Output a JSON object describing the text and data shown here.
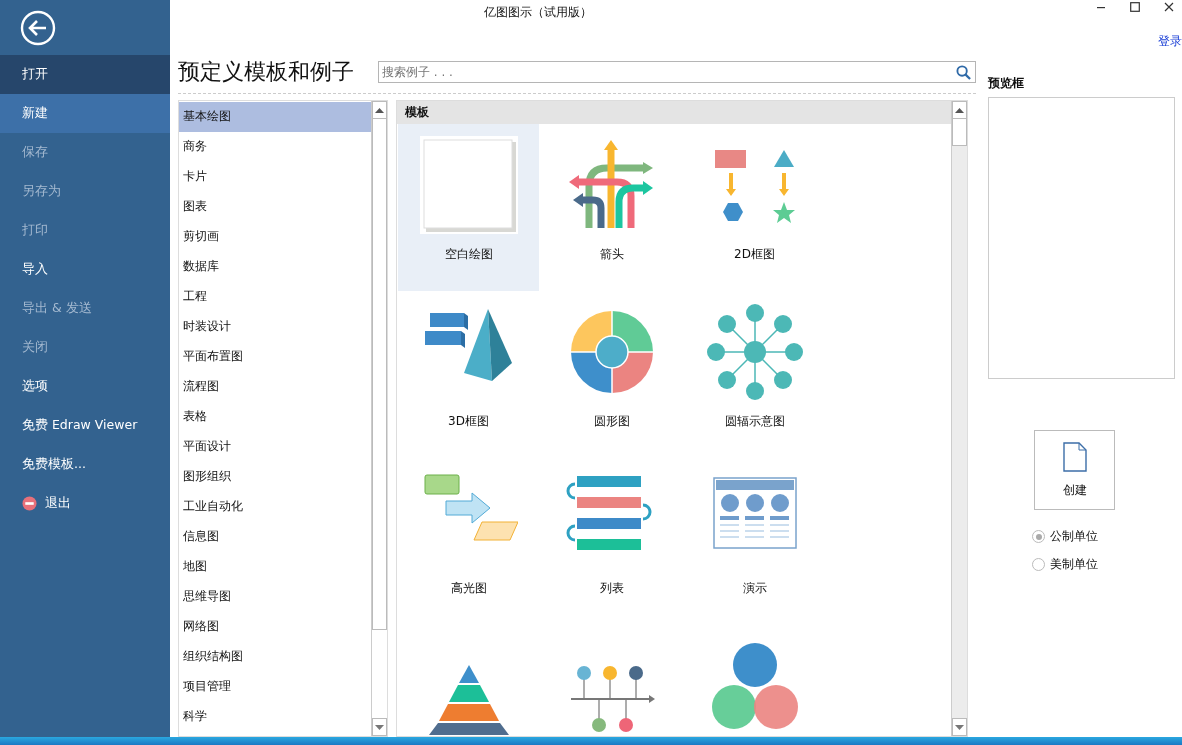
{
  "window": {
    "title": "亿图图示（试用版）",
    "login_link": "登录"
  },
  "sidebar": {
    "items": [
      {
        "label": "打开",
        "kind": "item",
        "selected": true,
        "disabled": false
      },
      {
        "label": "新建",
        "kind": "item",
        "selected": false,
        "highlighted": true,
        "disabled": false
      },
      {
        "label": "保存",
        "kind": "item",
        "selected": false,
        "disabled": true
      },
      {
        "label": "另存为",
        "kind": "item",
        "selected": false,
        "disabled": true
      },
      {
        "label": "打印",
        "kind": "item",
        "selected": false,
        "disabled": true
      },
      {
        "label": "导入",
        "kind": "item",
        "selected": false,
        "disabled": false
      },
      {
        "label": "导出 & 发送",
        "kind": "item",
        "selected": false,
        "disabled": true
      },
      {
        "label": "关闭",
        "kind": "item",
        "selected": false,
        "disabled": true
      },
      {
        "label": "选项",
        "kind": "item",
        "selected": false,
        "disabled": false
      },
      {
        "label": "免费 Edraw Viewer",
        "kind": "item",
        "selected": false,
        "disabled": false
      },
      {
        "label": "免费模板...",
        "kind": "item",
        "selected": false,
        "disabled": false
      },
      {
        "label": "退出",
        "kind": "exit",
        "selected": false,
        "disabled": false
      }
    ]
  },
  "heading": "预定义模板和例子",
  "search": {
    "placeholder": "搜索例子 . . ."
  },
  "categories": [
    {
      "label": "基本绘图",
      "selected": true
    },
    {
      "label": "商务",
      "selected": false
    },
    {
      "label": "卡片",
      "selected": false
    },
    {
      "label": "图表",
      "selected": false
    },
    {
      "label": "剪切画",
      "selected": false
    },
    {
      "label": "数据库",
      "selected": false
    },
    {
      "label": "工程",
      "selected": false
    },
    {
      "label": "时装设计",
      "selected": false
    },
    {
      "label": "平面布置图",
      "selected": false
    },
    {
      "label": "流程图",
      "selected": false
    },
    {
      "label": "表格",
      "selected": false
    },
    {
      "label": "平面设计",
      "selected": false
    },
    {
      "label": "图形组织",
      "selected": false
    },
    {
      "label": "工业自动化",
      "selected": false
    },
    {
      "label": "信息图",
      "selected": false
    },
    {
      "label": "地图",
      "selected": false
    },
    {
      "label": "思维导图",
      "selected": false
    },
    {
      "label": "网络图",
      "selected": false
    },
    {
      "label": "组织结构图",
      "selected": false
    },
    {
      "label": "项目管理",
      "selected": false
    },
    {
      "label": "科学",
      "selected": false
    }
  ],
  "templates": {
    "header": "模板",
    "items": [
      {
        "label": "空白绘图",
        "kind": "blank",
        "selected": true
      },
      {
        "label": "箭头",
        "kind": "arrows",
        "selected": false
      },
      {
        "label": "2D框图",
        "kind": "block2d",
        "selected": false
      },
      {
        "label": "3D框图",
        "kind": "block3d",
        "selected": false
      },
      {
        "label": "圆形图",
        "kind": "circle",
        "selected": false
      },
      {
        "label": "圆辐示意图",
        "kind": "radial",
        "selected": false
      },
      {
        "label": "高光图",
        "kind": "highlight",
        "selected": false
      },
      {
        "label": "列表",
        "kind": "list",
        "selected": false
      },
      {
        "label": "演示",
        "kind": "presentation",
        "selected": false
      },
      {
        "kind": "pyramid",
        "selected": false
      },
      {
        "kind": "timeline",
        "selected": false
      },
      {
        "kind": "venn",
        "selected": false
      }
    ]
  },
  "preview": {
    "title": "预览框"
  },
  "create_button": "创建",
  "units": [
    {
      "label": "公制单位",
      "selected": true
    },
    {
      "label": "美制单位",
      "selected": false
    }
  ]
}
